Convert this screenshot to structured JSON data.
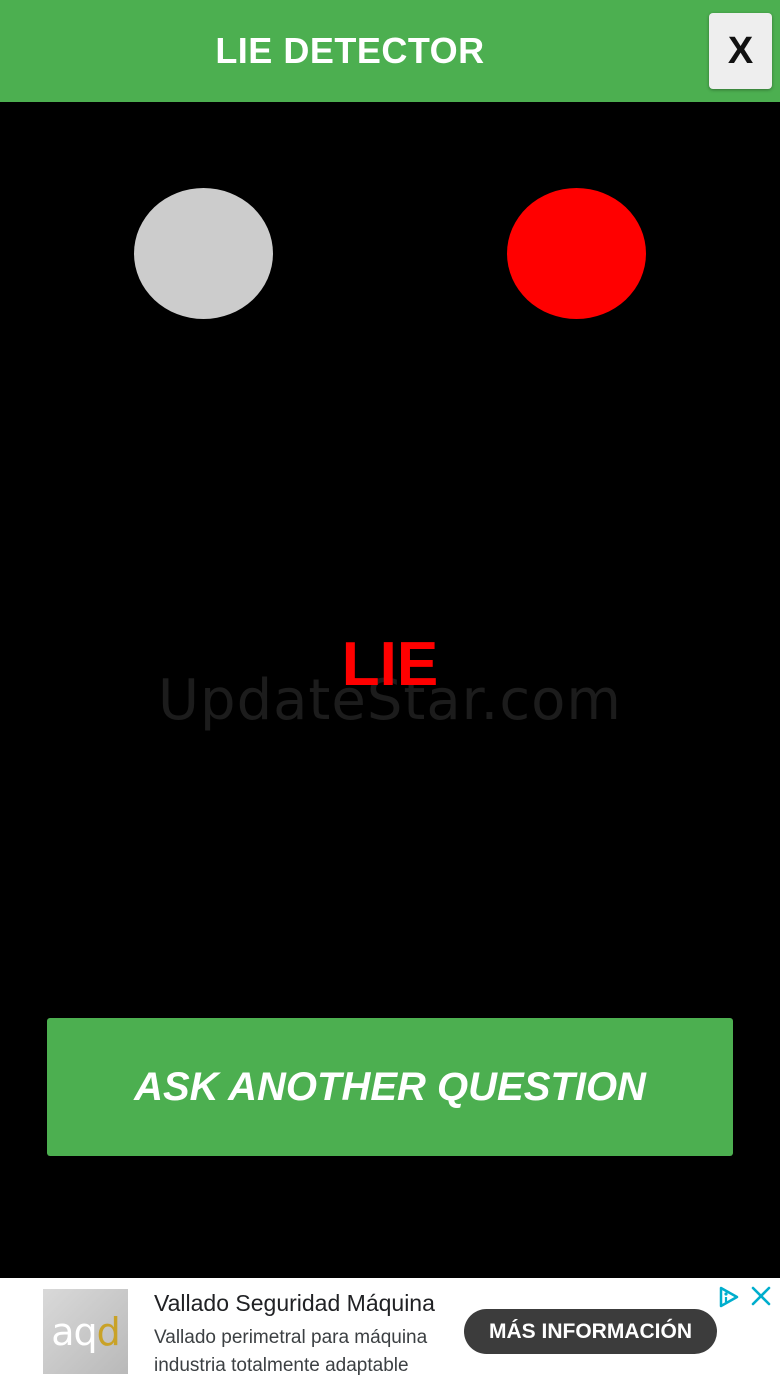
{
  "header": {
    "title": "LIE DETECTOR",
    "close_label": "X",
    "background_color": "#4caf50"
  },
  "indicators": {
    "truth": {
      "color": "#cccccc",
      "state": "off"
    },
    "lie": {
      "color": "#ff0000",
      "state": "on"
    }
  },
  "result": {
    "text": "LIE",
    "color": "#ff0000"
  },
  "watermark": {
    "text": "UpdateStar.com"
  },
  "actions": {
    "ask_label": "ASK ANOTHER QUESTION"
  },
  "ad": {
    "logo_text_main": "aq",
    "logo_text_accent": "d",
    "title": "Vallado Seguridad Máquina",
    "description": "Vallado perimetral para máquina industria totalmente adaptable",
    "cta_label": "MÁS INFORMACIÓN",
    "choices_icon": "adchoices-icon",
    "close_icon": "close-icon"
  }
}
